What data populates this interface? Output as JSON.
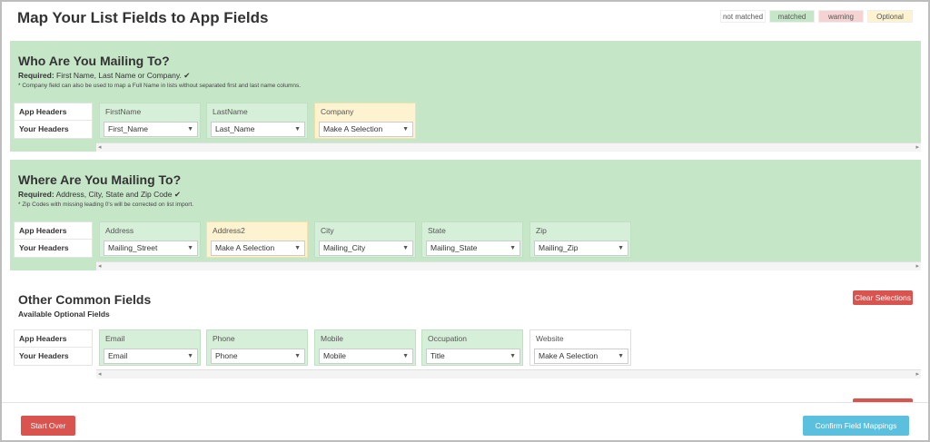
{
  "page": {
    "title": "Map Your List Fields to App Fields",
    "legend": [
      {
        "label": "not matched",
        "color": "#ffffff"
      },
      {
        "label": "matched",
        "color": "#c6e6c8"
      },
      {
        "label": "warning",
        "color": "#f6d3d3"
      },
      {
        "label": "Optional",
        "color": "#fdf3d0"
      }
    ]
  },
  "labels": {
    "app_headers": "App Headers",
    "your_headers": "Your Headers"
  },
  "who": {
    "title": "Who Are You Mailing To?",
    "req_label": "Required:",
    "req_text": "First Name, Last Name or Company.",
    "check": "✔",
    "note": "* Company field can also be used to map a Full Name in lists without separated first and last name columns.",
    "fields": [
      {
        "header": "FirstName",
        "value": "First_Name",
        "state": "matched"
      },
      {
        "header": "LastName",
        "value": "Last_Name",
        "state": "matched"
      },
      {
        "header": "Company",
        "value": "Make A Selection",
        "state": "optional"
      }
    ]
  },
  "where": {
    "title": "Where Are You Mailing To?",
    "req_label": "Required:",
    "req_text": "Address, City, State and Zip Code",
    "check": "✔",
    "note": "* Zip Codes with missing leading 0's will be corrected on list import.",
    "fields": [
      {
        "header": "Address",
        "value": "Mailing_Street",
        "state": "matched"
      },
      {
        "header": "Address2",
        "value": "Make A Selection",
        "state": "optional"
      },
      {
        "header": "City",
        "value": "Mailing_City",
        "state": "matched"
      },
      {
        "header": "State",
        "value": "Mailing_State",
        "state": "matched"
      },
      {
        "header": "Zip",
        "value": "Mailing_Zip",
        "state": "matched"
      }
    ]
  },
  "other": {
    "title": "Other Common Fields",
    "subtitle": "Available Optional Fields",
    "clear_label": "Clear Selections",
    "fields": [
      {
        "header": "Email",
        "value": "Email",
        "state": "matched"
      },
      {
        "header": "Phone",
        "value": "Phone",
        "state": "matched"
      },
      {
        "header": "Mobile",
        "value": "Mobile",
        "state": "matched"
      },
      {
        "header": "Occupation",
        "value": "Title",
        "state": "matched"
      },
      {
        "header": "Website",
        "value": "Make A Selection",
        "state": "none"
      }
    ]
  },
  "footer": {
    "start_over": "Start Over",
    "confirm": "Confirm Field Mappings"
  }
}
